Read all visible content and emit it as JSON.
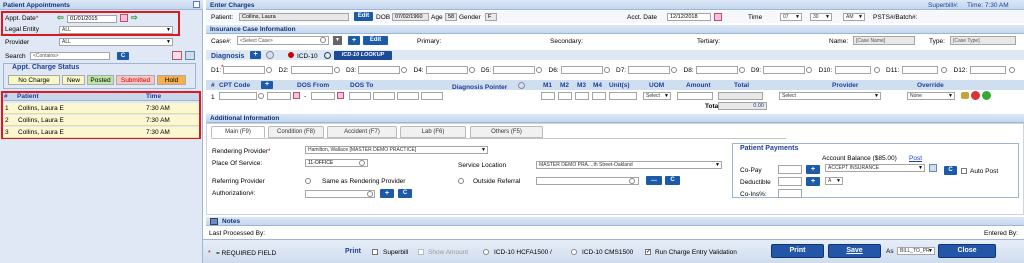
{
  "left": {
    "title": "Patient Appointments",
    "appt_date_label": "Appt. Date",
    "appt_date_value": "01/01/2015",
    "legal_entity_label": "Legal Entity",
    "legal_entity_value": "ALL",
    "provider_label": "Provider",
    "provider_value": "ALL",
    "search_label": "Search",
    "search_placeholder": "<Contains>",
    "search_btn": "C",
    "charge_status_title": "Appt. Charge Status",
    "status": [
      {
        "label": "No Charge",
        "color": "#f7f7c8"
      },
      {
        "label": "New",
        "color": "#f7f7c8"
      },
      {
        "label": "Posted",
        "color": "#bde6a6"
      },
      {
        "label": "Submitted",
        "color": "#f5c6c6"
      },
      {
        "label": "Hold",
        "color": "#f5b04d"
      }
    ],
    "col_num": "#",
    "col_patient": "Patient",
    "col_time": "Time",
    "rows": [
      {
        "num": "1",
        "patient": "Collins, Laura E",
        "time": "7:30 AM"
      },
      {
        "num": "2",
        "patient": "Collins, Laura E",
        "time": "7:30 AM"
      },
      {
        "num": "3",
        "patient": "Collins, Laura E",
        "time": "7:30 AM"
      }
    ]
  },
  "enter": {
    "title": "Enter Charges",
    "superbill": "Superbill#:",
    "time_display": "Time: 7:30 AM",
    "patient_label": "Patient:",
    "patient_value": "Collins, Laura",
    "edit": "Edit",
    "dob_label": "DOB",
    "dob_value": "07/02/1960",
    "age_label": "Age",
    "age_value": "58",
    "gender_label": "Gender",
    "gender_value": "F",
    "acct_date_label": "Acct. Date",
    "acct_date_value": "12/12/2018",
    "time_label": "Time",
    "hour": "07",
    "minute": "30",
    "ampm": "AM",
    "psts_label": "PSTS#/Batch#:"
  },
  "case": {
    "title": "Insurance Case Information",
    "case_label": "Case#:",
    "case_placeholder": "<Select Case>",
    "plus": "+",
    "edit": "Edit",
    "primary": "Primary:",
    "secondary": "Secondary:",
    "tertiary": "Tertiary:",
    "name_label": "Name:",
    "name_value": "[Case Name]",
    "type_label": "Type:",
    "type_value": "[Case Type]"
  },
  "diag": {
    "label": "Diagnosis",
    "icd10": "ICD-10",
    "lookup": "ICD-10 LOOKUP",
    "codes": [
      "D1:",
      "D2:",
      "D3:",
      "D4:",
      "D5:",
      "D6:",
      "D7:",
      "D8:",
      "D9:",
      "D10:",
      "D11:",
      "D12:"
    ]
  },
  "cpt": {
    "headers": [
      "#",
      "CPT Code",
      "DOS From",
      "DOS To",
      "Diagnosis Pointer",
      "M1",
      "M2",
      "M3",
      "M4",
      "Unit(s)",
      "UOM",
      "Amount",
      "Total",
      "Provider",
      "Override"
    ],
    "row_num": "1",
    "dash": "-",
    "uom": "Select",
    "provider": "Select",
    "override": "None",
    "total_label": "Total",
    "total_value": "0.00"
  },
  "additional": {
    "title": "Additional Information",
    "tabs": [
      "Main (F9)",
      "Condition (F8)",
      "Accident (F7)",
      "Lab (F6)",
      "Others (F5)"
    ],
    "rendering_provider_label": "Rendering Provider",
    "rendering_provider_value": "Hamilton, Wallace [MASTER DEMO PRACTICE]",
    "pos_label": "Place Of Service:",
    "pos_value": "11-OFFICE",
    "service_location_label": "Service Location",
    "service_location_value": "MASTER DEMO PRA....th Street-Oakland",
    "referring_label": "Referring Provider",
    "same_as": "Same as Rendering Provider",
    "outside_referral": "Outside Referral",
    "authorization_label": "Authorization#:",
    "dots": "...",
    "c": "C"
  },
  "payments": {
    "title": "Patient Payments",
    "account_balance": "Account Balance ($85.00)",
    "post_link": "Post",
    "copay": "Co-Pay",
    "deductible": "Deductible",
    "coins": "Co-Ins%:",
    "accept": "ACCEPT INSURANCE",
    "a": "A",
    "auto_post": "Auto Post"
  },
  "notes": {
    "title": "Notes",
    "last_processed": "Last Processed By:",
    "entered_by": "Entered By:"
  },
  "footer": {
    "required": "= REQUIRED FIELD",
    "print_label": "Print",
    "superbill": "Superbill",
    "show_amount": "Show Amount",
    "icd_hcfa": "ICD-10 HCFA1500 /",
    "icd_cms": "ICD-10 CMS1500",
    "run_validation": "Run Charge Entry Validation",
    "print_btn": "Print",
    "save_btn": "Save",
    "as_label": "As",
    "as_value": "BILL_TO_PR",
    "close_btn": "Close"
  }
}
